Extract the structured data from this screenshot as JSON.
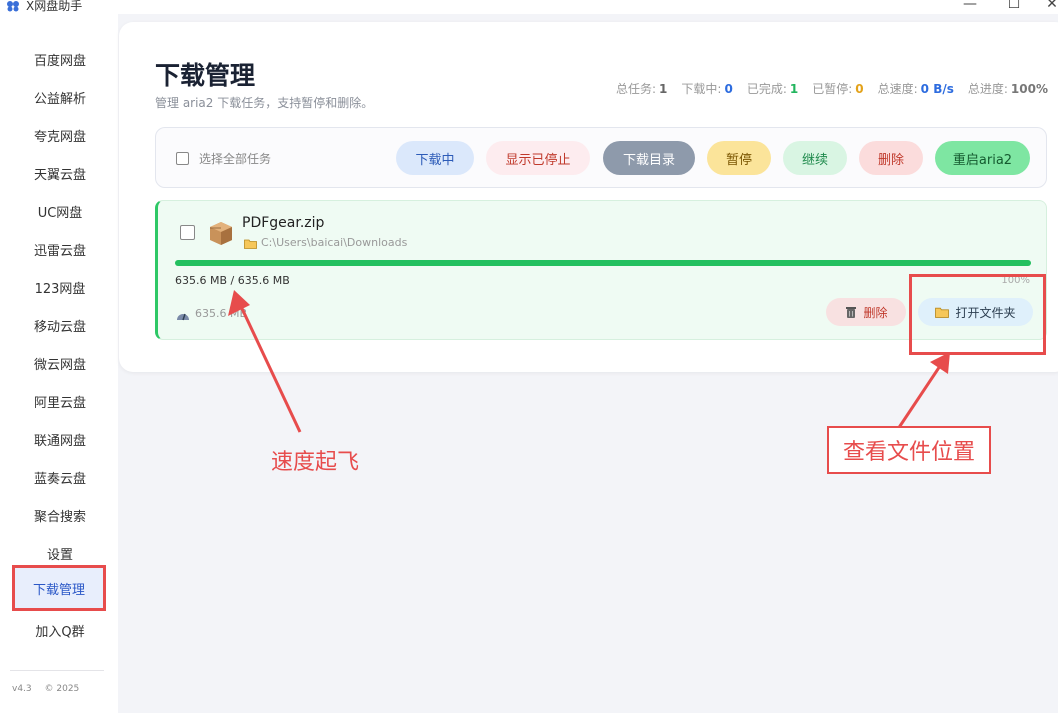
{
  "app": {
    "title": "X网盘助手",
    "icons": {
      "logo": "app-logo-icon"
    }
  },
  "window_controls": {
    "minimize": "—",
    "maximize": "☐",
    "close": "✕"
  },
  "sidebar": {
    "items": [
      {
        "label": "百度网盘"
      },
      {
        "label": "公益解析"
      },
      {
        "label": "夸克网盘"
      },
      {
        "label": "天翼云盘"
      },
      {
        "label": "UC网盘"
      },
      {
        "label": "迅雷云盘"
      },
      {
        "label": "123网盘"
      },
      {
        "label": "移动云盘"
      },
      {
        "label": "微云网盘"
      },
      {
        "label": "阿里云盘"
      },
      {
        "label": "联通网盘"
      },
      {
        "label": "蓝奏云盘"
      },
      {
        "label": "聚合搜索"
      },
      {
        "label": "设置"
      },
      {
        "label": "下载管理",
        "active": true
      },
      {
        "label": "加入Q群"
      }
    ],
    "footer": {
      "version": "v4.3",
      "copyright": "© 2025"
    }
  },
  "header": {
    "title": "下载管理",
    "subtitle": "管理 aria2 下载任务，支持暂停和删除。",
    "stats": {
      "total_label": "总任务:",
      "total": "1",
      "downloading_label": "下载中:",
      "downloading": "0",
      "completed_label": "已完成:",
      "completed": "1",
      "paused_label": "已暂停:",
      "paused": "0",
      "speed_label": "总速度:",
      "speed": "0 B/s",
      "progress_label": "总进度:",
      "progress": "100%"
    }
  },
  "toolbar": {
    "select_all": "选择全部任务",
    "downloading": "下载中",
    "show_stopped": "显示已停止",
    "download_dir": "下载目录",
    "pause": "暂停",
    "resume": "继续",
    "delete": "删除",
    "restart": "重启aria2"
  },
  "task": {
    "name": "PDFgear.zip",
    "path": "C:\\Users\\baicai\\Downloads",
    "size": "635.6 MB / 635.6 MB",
    "percent_label": "100%",
    "progress_fraction": 1.0,
    "speed": "635.6 MB",
    "delete": "删除",
    "open_folder": "打开文件夹",
    "icons": {
      "file": "package-icon",
      "folder": "folder-icon",
      "speed": "speed-icon",
      "delete": "trash-icon"
    }
  },
  "annotations": {
    "speed": "速度起飞",
    "location": "查看文件位置"
  },
  "colors": {
    "accent_red": "#e74c4c",
    "progress_green": "#23c05f",
    "blue": "#2d6cdf"
  }
}
